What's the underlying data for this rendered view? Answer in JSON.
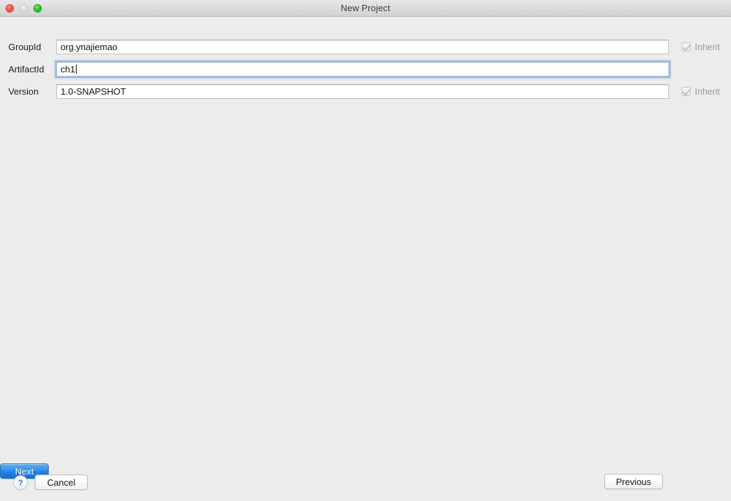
{
  "window": {
    "title": "New Project",
    "traffic_lights": [
      {
        "name": "close",
        "color": "#f9564f"
      },
      {
        "name": "minimize",
        "color": "#dcdcdc"
      },
      {
        "name": "zoom",
        "color": "#2bc72b"
      }
    ]
  },
  "form": {
    "rows": [
      {
        "label": "GroupId",
        "value": "org.ynajiemao",
        "focused": false,
        "inherit_label": "Inherit",
        "inherit_checked": true
      },
      {
        "label": "ArtifactId",
        "value": "ch1",
        "focused": true,
        "inherit_label": "",
        "inherit_checked": false
      },
      {
        "label": "Version",
        "value": "1.0-SNAPSHOT",
        "focused": false,
        "inherit_label": "Inherit",
        "inherit_checked": true
      }
    ]
  },
  "footer": {
    "help_label": "?",
    "cancel_label": "Cancel",
    "previous_label": "Previous",
    "next_label": "Next",
    "next_accent_color": "#2180e0"
  }
}
